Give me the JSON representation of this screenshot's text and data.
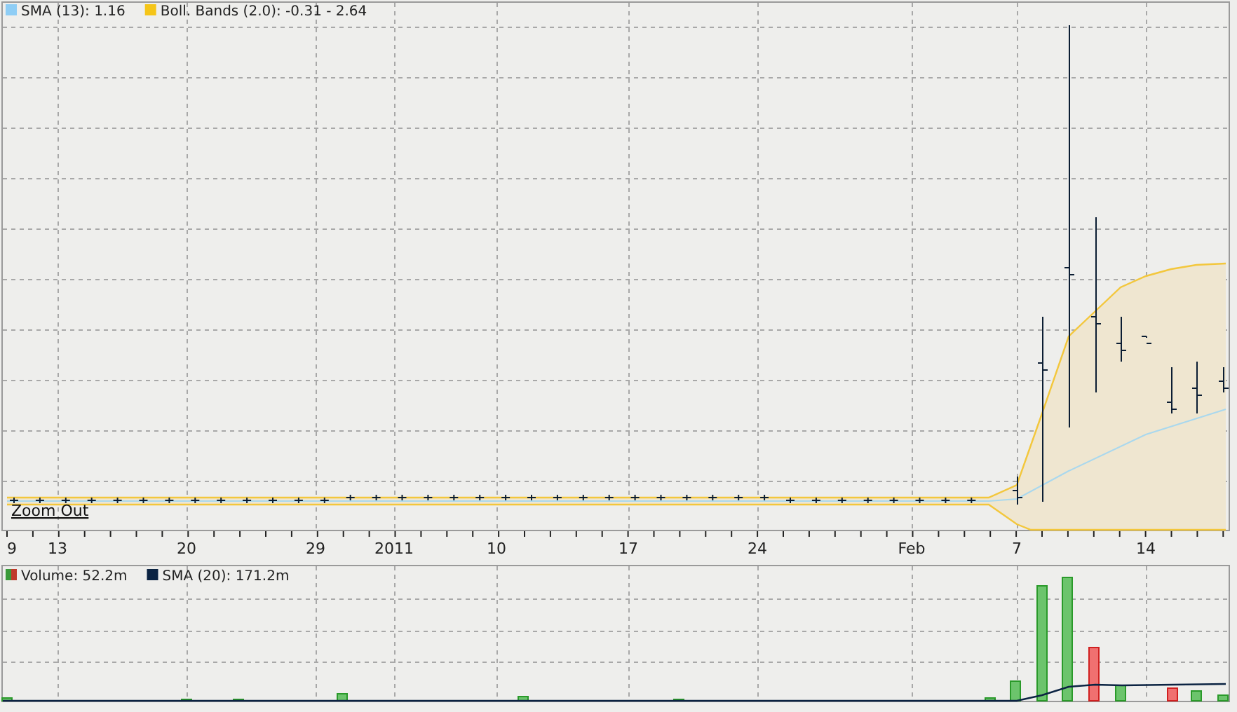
{
  "price_legend": [
    {
      "label": "SMA (13): 1.16",
      "color": "#8ecdf5"
    },
    {
      "label": "Boll. Bands (2.0): -0.31 - 2.64",
      "color": "#f5c518"
    }
  ],
  "zoom_link": "Zoom Out",
  "x_axis_labels": [
    "9",
    "13",
    "20",
    "29",
    "2011",
    "10",
    "17",
    "24",
    "Feb",
    "7",
    "14"
  ],
  "volume_legend": [
    {
      "label": "Volume: 52.2m",
      "color": "#3a9a3a",
      "kind": "updown"
    },
    {
      "label": "SMA (20): 171.2m",
      "color": "#0b2342",
      "kind": "solid"
    }
  ]
}
